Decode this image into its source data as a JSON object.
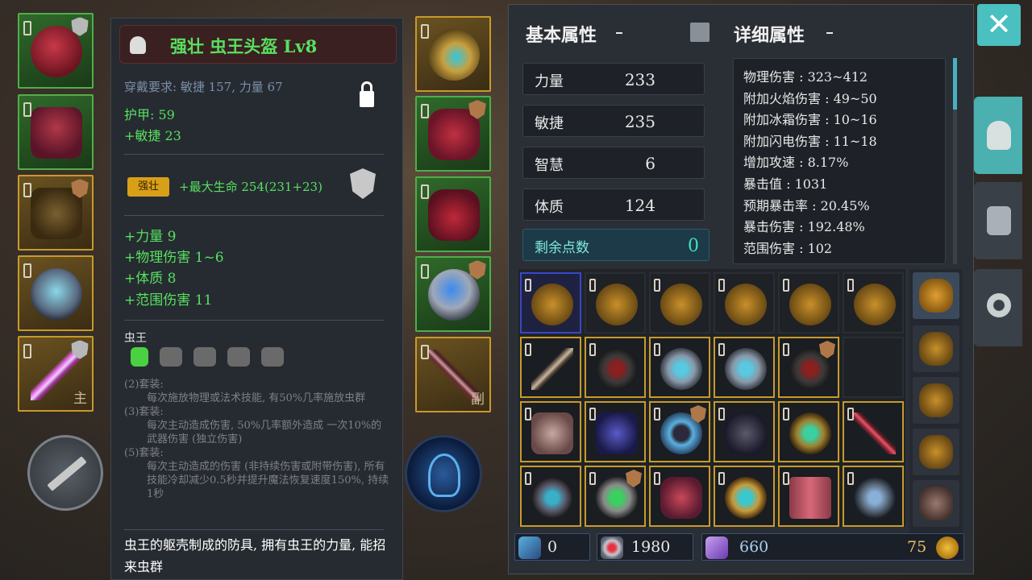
{
  "tooltip": {
    "title": "强壮 虫王头盔 Lv8",
    "requirement": "穿戴要求:  敏捷 157, 力量 67",
    "armor": "护甲:  59",
    "bonus1": "+敏捷 23",
    "quality_badge": "强壮",
    "quality_stat": "+最大生命 254(231+23)",
    "affixes": [
      "+力量 9",
      "+物理伤害 1~6",
      "+体质 8",
      "+范围伤害 11"
    ],
    "set_name": "虫王",
    "set_bonuses": [
      {
        "label": "(2)套装:",
        "text": "每次施放物理或法术技能, 有50%几率施放虫群"
      },
      {
        "label": "(3)套装:",
        "text": "每次主动造成伤害, 50%几率额外造成 一次10%的武器伤害 (独立伤害)"
      },
      {
        "label": "(5)套装:",
        "text": "每次主动造成的伤害 (非持续伤害或附带伤害), 所有技能冷却减少0.5秒并提升魔法恢复速度150%, 持续1秒"
      }
    ],
    "flavor": "虫王的躯壳制成的防具, 拥有虫王的力量, 能招来虫群"
  },
  "equip_slots": {
    "main_hand_tag": "主",
    "off_hand_tag": "副"
  },
  "stats_panel": {
    "basic_title": "基本属性",
    "detail_title": "详细属性",
    "basic": [
      {
        "name": "力量",
        "value": "233"
      },
      {
        "name": "敏捷",
        "value": "235"
      },
      {
        "name": "智慧",
        "value": "6"
      },
      {
        "name": "体质",
        "value": "124"
      }
    ],
    "remaining_label": "剩余点数",
    "remaining_value": "0",
    "details": [
      "物理伤害 : 323~412",
      "附加火焰伤害 : 49~50",
      "附加冰霜伤害 : 10~16",
      "附加闪电伤害 : 11~18",
      "增加攻速 : 8.17%",
      "暴击值 : 1031",
      "预期暴击率 : 20.45%",
      "暴击伤害 : 192.48%",
      "范围伤害 : 102"
    ]
  },
  "currency": {
    "scrolls": "0",
    "gems": "1980",
    "crystals": "660",
    "gold": "75"
  },
  "colors": {
    "accent": "#4ac0c0",
    "item_green": "#58e060",
    "border_gold": "#c89a2a"
  },
  "icons": {
    "close": "close-icon",
    "helmet_tab": "helmet-icon",
    "gloves_tab": "gloves-icon",
    "lifebuoy_tab": "lifebuoy-icon"
  }
}
